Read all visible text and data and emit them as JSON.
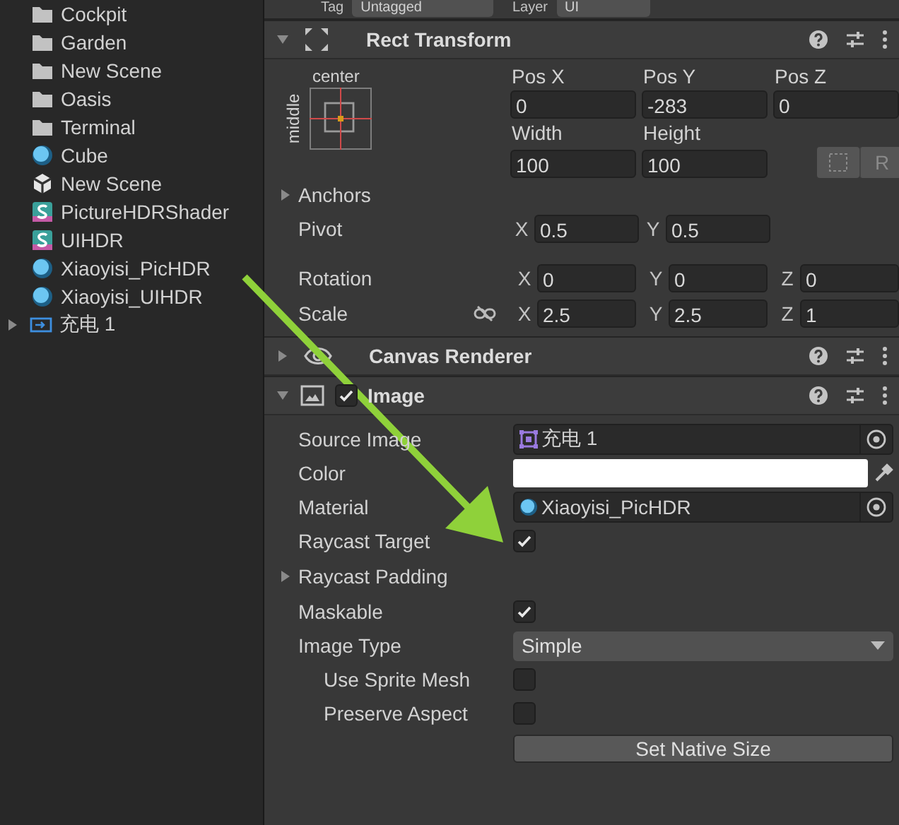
{
  "project": {
    "items": [
      {
        "kind": "folder",
        "name": "Cockpit"
      },
      {
        "kind": "folder",
        "name": "Garden"
      },
      {
        "kind": "folder",
        "name": "New Scene"
      },
      {
        "kind": "folder",
        "name": "Oasis"
      },
      {
        "kind": "folder",
        "name": "Terminal"
      },
      {
        "kind": "material",
        "name": "Cube"
      },
      {
        "kind": "scene",
        "name": "New Scene"
      },
      {
        "kind": "shader",
        "name": "PictureHDRShader"
      },
      {
        "kind": "shader",
        "name": "UIHDR"
      },
      {
        "kind": "material",
        "name": "Xiaoyisi_PicHDR"
      },
      {
        "kind": "material",
        "name": "Xiaoyisi_UIHDR"
      },
      {
        "kind": "sprite",
        "name": "充电 1",
        "expanded": false
      }
    ]
  },
  "inspector": {
    "tag": {
      "label": "Tag",
      "value": "Untagged"
    },
    "layer": {
      "label": "Layer",
      "value": "UI"
    },
    "rect_transform": {
      "title": "Rect Transform",
      "expanded": true,
      "anchor": {
        "horizontal": "center",
        "vertical": "middle"
      },
      "position": [
        {
          "label": "Pos X",
          "value": "0"
        },
        {
          "label": "Pos Y",
          "value": "-283"
        },
        {
          "label": "Pos Z",
          "value": "0"
        }
      ],
      "size": [
        {
          "label": "Width",
          "value": "100"
        },
        {
          "label": "Height",
          "value": "100"
        }
      ],
      "raw_edit_button": "R",
      "anchors": {
        "label": "Anchors",
        "expanded": false
      },
      "vectors": [
        {
          "label": "Pivot",
          "values": [
            {
              "axis": "X",
              "value": "0.5"
            },
            {
              "axis": "Y",
              "value": "0.5"
            }
          ]
        },
        {
          "label": "Rotation",
          "values": [
            {
              "axis": "X",
              "value": "0"
            },
            {
              "axis": "Y",
              "value": "0"
            },
            {
              "axis": "Z",
              "value": "0"
            }
          ]
        },
        {
          "label": "Scale",
          "linked": false,
          "values": [
            {
              "axis": "X",
              "value": "2.5"
            },
            {
              "axis": "Y",
              "value": "2.5"
            },
            {
              "axis": "Z",
              "value": "1"
            }
          ]
        }
      ]
    },
    "canvas_renderer": {
      "title": "Canvas Renderer",
      "expanded": false
    },
    "image": {
      "title": "Image",
      "expanded": true,
      "enabled": true,
      "properties": [
        {
          "kind": "object",
          "label": "Source Image",
          "icon": {
            "kind": "sprite"
          },
          "value": "充电 1"
        },
        {
          "kind": "color",
          "label": "Color",
          "color": "#ffffff"
        },
        {
          "kind": "object",
          "label": "Material",
          "icon": {
            "kind": "material"
          },
          "value": "Xiaoyisi_PicHDR"
        },
        {
          "kind": "checkbox",
          "label": "Raycast Target",
          "checked": true
        },
        {
          "kind": "foldout",
          "label": "Raycast Padding",
          "expanded": false
        },
        {
          "kind": "checkbox",
          "label": "Maskable",
          "checked": true
        },
        {
          "kind": "dropdown",
          "label": "Image Type",
          "value": "Simple",
          "children": [
            {
              "kind": "checkbox",
              "label": "Use Sprite Mesh",
              "checked": false
            },
            {
              "kind": "checkbox",
              "label": "Preserve Aspect",
              "checked": false
            }
          ]
        },
        {
          "kind": "button",
          "label": "Set Native Size"
        }
      ]
    }
  }
}
